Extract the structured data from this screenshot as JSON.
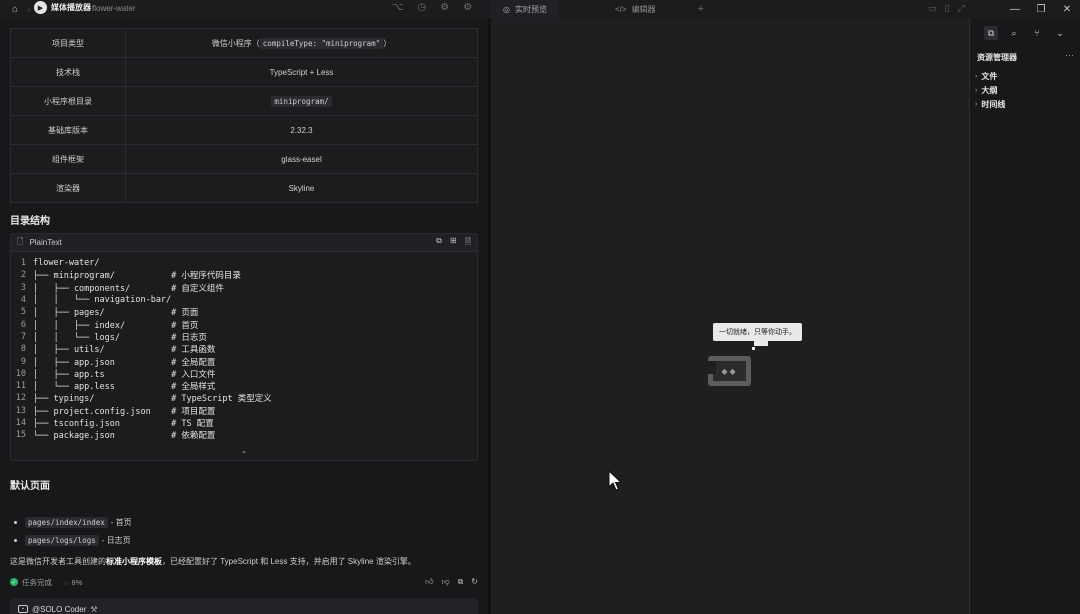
{
  "topbar": {
    "media_player_label": "媒体播放器",
    "project_name": "flower-water",
    "tabs": [
      {
        "label": "实时预览",
        "icon": "globe-icon"
      },
      {
        "label": "编辑器",
        "icon": "code-icon"
      }
    ]
  },
  "project_info": {
    "rows": [
      {
        "key": "项目类型",
        "value_prefix": "微信小程序（",
        "value_code": "compileType: \"miniprogram\"",
        "value_suffix": "）"
      },
      {
        "key": "技术栈",
        "value": "TypeScript + Less"
      },
      {
        "key": "小程序根目录",
        "value_code": "miniprogram/"
      },
      {
        "key": "基础库版本",
        "value": "2.32.3"
      },
      {
        "key": "组件框架",
        "value": "glass-easel"
      },
      {
        "key": "渲染器",
        "value": "Skyline"
      }
    ]
  },
  "dir_section_title": "目录结构",
  "code_block": {
    "language": "PlainText",
    "lines": [
      "flower-water/",
      "├── miniprogram/           # 小程序代码目录",
      "│   ├── components/        # 自定义组件",
      "│   │   └── navigation-bar/",
      "│   ├── pages/             # 页面",
      "│   │   ├── index/         # 首页",
      "│   │   └── logs/          # 日志页",
      "│   ├── utils/             # 工具函数",
      "│   ├── app.json           # 全局配置",
      "│   ├── app.ts             # 入口文件",
      "│   └── app.less           # 全局样式",
      "├── typings/               # TypeScript 类型定义",
      "├── project.config.json    # 项目配置",
      "├── tsconfig.json          # TS 配置",
      "└── package.json           # 依赖配置"
    ]
  },
  "default_pages": {
    "title": "默认页面",
    "items": [
      {
        "code": "pages/index/index",
        "desc": "- 首页"
      },
      {
        "code": "pages/logs/logs",
        "desc": "- 日志页"
      }
    ]
  },
  "summary": {
    "before": "这是微信开发者工具创建的",
    "bold": "标准小程序模板",
    "after": "，已经配置好了 TypeScript 和 Less 支持，并启用了 Skyline 渲染引擎。"
  },
  "status": {
    "done_label": "任务完成",
    "percent": "8%"
  },
  "mention": {
    "label": "@SOLO Coder"
  },
  "preview": {
    "tooltip": "一切就绪，只等你动手。"
  },
  "explorer": {
    "title": "资源管理器",
    "items": [
      "文件",
      "大纲",
      "时间线"
    ]
  }
}
